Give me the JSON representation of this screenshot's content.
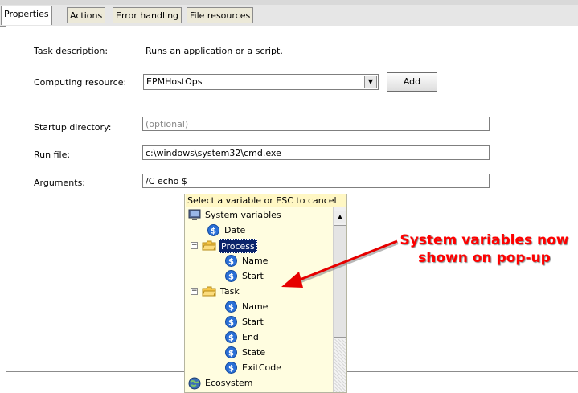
{
  "tabs": [
    "Properties",
    "Actions",
    "Error handling",
    "File resources"
  ],
  "form": {
    "task_description_label": "Task description:",
    "task_description_value": "Runs an application or a script.",
    "computing_resource_label": "Computing resource:",
    "computing_resource_value": "EPMHostOps",
    "add_button": "Add",
    "startup_directory_label": "Startup directory:",
    "startup_directory_placeholder": "(optional)",
    "run_file_label": "Run file:",
    "run_file_value": "c:\\windows\\system32\\cmd.exe",
    "arguments_label": "Arguments:",
    "arguments_value": "/C echo $"
  },
  "popup": {
    "header": "Select a variable or ESC to cancel",
    "items": [
      {
        "label": "System variables",
        "icon": "monitor-icon"
      },
      {
        "label": "Date",
        "icon": "variable-icon"
      },
      {
        "label": "Process",
        "icon": "folder-icon",
        "selected": true
      },
      {
        "label": "Name",
        "icon": "variable-icon"
      },
      {
        "label": "Start",
        "icon": "variable-icon"
      },
      {
        "label": "Task",
        "icon": "folder-icon"
      },
      {
        "label": "Name",
        "icon": "variable-icon"
      },
      {
        "label": "Start",
        "icon": "variable-icon"
      },
      {
        "label": "End",
        "icon": "variable-icon"
      },
      {
        "label": "State",
        "icon": "variable-icon"
      },
      {
        "label": "ExitCode",
        "icon": "variable-icon"
      },
      {
        "label": "Ecosystem",
        "icon": "globe-icon"
      }
    ]
  },
  "annotation": {
    "text": "System variables now shown on pop-up",
    "color": "#ff0000"
  },
  "colors": {
    "selection": "#0a246a",
    "popup_bg": "#fffde0",
    "variable_icon": "#2a6fd6"
  }
}
